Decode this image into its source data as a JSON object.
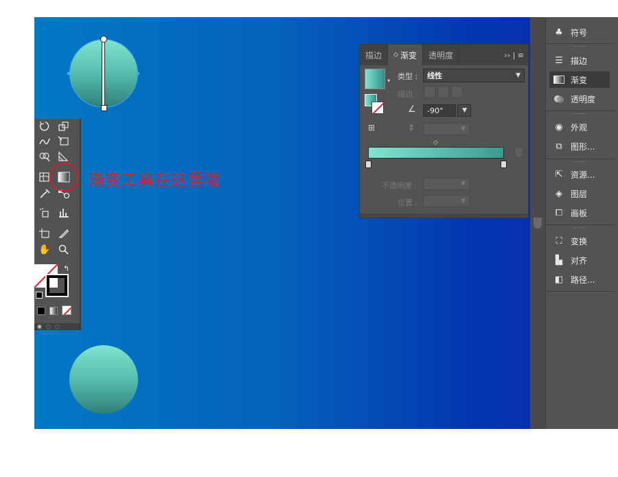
{
  "annotation": {
    "text": "渐变工具在这里哦",
    "color": "#d8232f"
  },
  "gradient_panel": {
    "tabs": [
      "描边",
      "渐变",
      "透明度"
    ],
    "active_tab": "渐变",
    "tab_marker": "◇",
    "more": "›› | ≡",
    "type_label": "类型 :",
    "type_value": "线性",
    "stroke_label": "描边 :",
    "angle_value": "-90°",
    "opacity_label": "不透明度 :",
    "position_label": "位置 :",
    "start_color": "#7fe5d2",
    "end_color": "#3a9b90"
  },
  "right_panel": {
    "items": [
      {
        "label": "符号",
        "icon": "club-icon"
      },
      {
        "label": "描边",
        "icon": "stroke-lines-icon"
      },
      {
        "label": "渐变",
        "icon": "gradient-icon",
        "active": true
      },
      {
        "label": "透明度",
        "icon": "transparency-icon"
      },
      {
        "label": "外观",
        "icon": "appearance-icon"
      },
      {
        "label": "图形...",
        "icon": "graphic-styles-icon"
      },
      {
        "label": "资源...",
        "icon": "asset-export-icon"
      },
      {
        "label": "图层",
        "icon": "layers-icon"
      },
      {
        "label": "画板",
        "icon": "artboards-icon"
      },
      {
        "label": "变换",
        "icon": "transform-icon"
      },
      {
        "label": "对齐",
        "icon": "align-icon"
      },
      {
        "label": "路径...",
        "icon": "pathfinder-icon"
      }
    ]
  },
  "colors": {
    "canvas_left": "#0379c2",
    "canvas_right": "#0a2ab0",
    "panel_bg": "#535353"
  }
}
